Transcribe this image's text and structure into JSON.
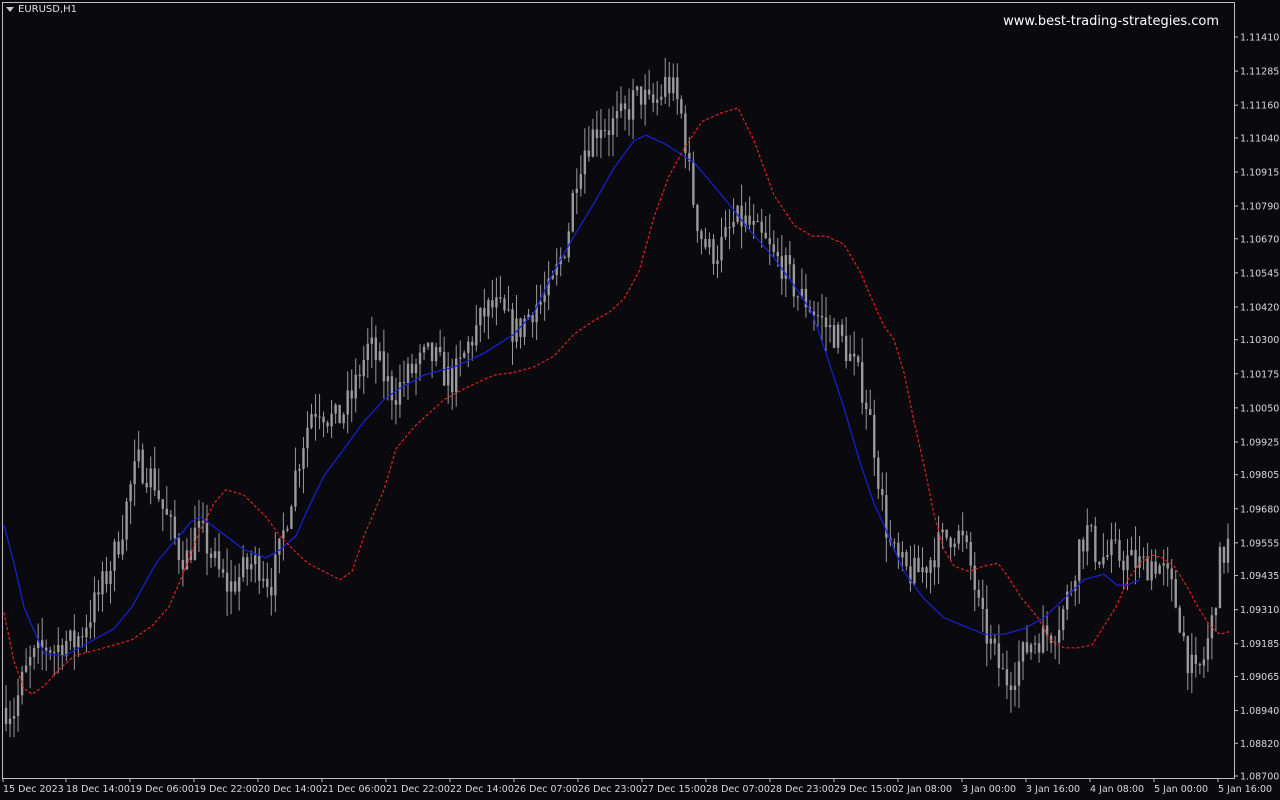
{
  "window": {
    "symbol_title": "EURUSD,H1",
    "watermark": "www.best-trading-strategies.com"
  },
  "colors": {
    "background": "#0a0a0e",
    "frame": "#bfbfbf",
    "candle": "#9a9a9a",
    "slow_ma": "#1a20d8",
    "fast_ma": "#e02020",
    "axis_text": "#d8d8d8"
  },
  "chart_data": {
    "type": "candlestick",
    "symbol": "EURUSD",
    "timeframe": "H1",
    "ylim": [
      1.087,
      1.115
    ],
    "y_ticks": [
      "1.11410",
      "1.11285",
      "1.11160",
      "1.11040",
      "1.10915",
      "1.10790",
      "1.10670",
      "1.10545",
      "1.10420",
      "1.10300",
      "1.10175",
      "1.10050",
      "1.09925",
      "1.09805",
      "1.09680",
      "1.09555",
      "1.09435",
      "1.09310",
      "1.09185",
      "1.09065",
      "1.08940",
      "1.08820",
      "1.08700"
    ],
    "x_ticks": [
      "15 Dec 2023",
      "18 Dec 14:00",
      "19 Dec 06:00",
      "19 Dec 22:00",
      "20 Dec 14:00",
      "21 Dec 06:00",
      "21 Dec 22:00",
      "22 Dec 14:00",
      "26 Dec 07:00",
      "26 Dec 23:00",
      "27 Dec 15:00",
      "28 Dec 07:00",
      "28 Dec 23:00",
      "29 Dec 15:00",
      "2 Jan 08:00",
      "3 Jan 00:00",
      "3 Jan 16:00",
      "4 Jan 08:00",
      "5 Jan 00:00",
      "5 Jan 16:00"
    ],
    "grid": false,
    "bar_count": 305,
    "close_path": [
      [
        0,
        1.0895
      ],
      [
        6,
        1.0894
      ],
      [
        12,
        1.0905
      ],
      [
        18,
        1.0912
      ],
      [
        24,
        1.0915
      ],
      [
        30,
        1.0918
      ],
      [
        36,
        1.0916
      ],
      [
        42,
        1.092
      ],
      [
        48,
        1.0918
      ],
      [
        54,
        1.0922
      ],
      [
        60,
        1.0928
      ],
      [
        66,
        1.0935
      ],
      [
        72,
        1.0942
      ],
      [
        78,
        1.095
      ],
      [
        84,
        1.096
      ],
      [
        90,
        1.0975
      ],
      [
        96,
        1.0985
      ],
      [
        102,
        1.0982
      ],
      [
        108,
        1.0978
      ],
      [
        114,
        1.0968
      ],
      [
        120,
        1.096
      ],
      [
        126,
        1.0952
      ],
      [
        132,
        1.095
      ],
      [
        138,
        1.096
      ],
      [
        144,
        1.0957
      ],
      [
        150,
        1.095
      ],
      [
        156,
        1.0943
      ],
      [
        162,
        1.0939
      ],
      [
        168,
        1.0942
      ],
      [
        174,
        1.0946
      ],
      [
        180,
        1.0948
      ],
      [
        186,
        1.0947
      ],
      [
        192,
        1.094
      ],
      [
        198,
        1.095
      ],
      [
        204,
        1.0965
      ],
      [
        210,
        1.098
      ],
      [
        216,
        1.0993
      ],
      [
        222,
        1.1004
      ],
      [
        228,
        1.1006
      ],
      [
        234,
        1.1002
      ],
      [
        240,
        1.1
      ],
      [
        246,
        1.1004
      ],
      [
        252,
        1.101
      ],
      [
        258,
        1.102
      ],
      [
        264,
        1.1028
      ],
      [
        270,
        1.1022
      ],
      [
        276,
        1.1015
      ],
      [
        282,
        1.101
      ],
      [
        288,
        1.1014
      ],
      [
        294,
        1.1018
      ],
      [
        300,
        1.1021
      ],
      [
        306,
        1.1024
      ],
      [
        312,
        1.1023
      ],
      [
        318,
        1.1018
      ],
      [
        324,
        1.1015
      ],
      [
        330,
        1.102
      ],
      [
        336,
        1.1028
      ],
      [
        342,
        1.1034
      ],
      [
        348,
        1.104
      ],
      [
        354,
        1.1042
      ],
      [
        360,
        1.104
      ],
      [
        366,
        1.1035
      ],
      [
        372,
        1.1033
      ],
      [
        378,
        1.1038
      ],
      [
        384,
        1.1043
      ],
      [
        390,
        1.1044
      ],
      [
        396,
        1.1048
      ],
      [
        402,
        1.1058
      ],
      [
        408,
        1.1068
      ],
      [
        414,
        1.109
      ],
      [
        420,
        1.11
      ],
      [
        426,
        1.1105
      ],
      [
        432,
        1.111
      ],
      [
        438,
        1.1108
      ],
      [
        444,
        1.111
      ],
      [
        450,
        1.1112
      ],
      [
        456,
        1.1118
      ],
      [
        462,
        1.112
      ],
      [
        468,
        1.1115
      ],
      [
        474,
        1.1118
      ],
      [
        480,
        1.1125
      ],
      [
        486,
        1.112
      ],
      [
        492,
        1.111
      ],
      [
        498,
        1.1085
      ],
      [
        504,
        1.107
      ],
      [
        510,
        1.1063
      ],
      [
        516,
        1.1062
      ],
      [
        522,
        1.1066
      ],
      [
        528,
        1.1072
      ],
      [
        534,
        1.1074
      ],
      [
        540,
        1.1072
      ],
      [
        546,
        1.1068
      ],
      [
        552,
        1.1065
      ],
      [
        558,
        1.106
      ],
      [
        564,
        1.1058
      ],
      [
        570,
        1.1052
      ],
      [
        576,
        1.1046
      ],
      [
        582,
        1.1044
      ],
      [
        588,
        1.104
      ],
      [
        594,
        1.1036
      ],
      [
        600,
        1.1033
      ],
      [
        606,
        1.1031
      ],
      [
        612,
        1.1025
      ],
      [
        618,
        1.1018
      ],
      [
        624,
        1.101
      ],
      [
        630,
        1.0995
      ],
      [
        636,
        1.0972
      ],
      [
        642,
        1.0955
      ],
      [
        648,
        1.0948
      ],
      [
        654,
        1.0945
      ],
      [
        660,
        1.0944
      ],
      [
        666,
        1.0946
      ],
      [
        672,
        1.095
      ],
      [
        678,
        1.0955
      ],
      [
        684,
        1.0958
      ],
      [
        690,
        1.096
      ],
      [
        696,
        1.0955
      ],
      [
        702,
        1.0945
      ],
      [
        708,
        1.0928
      ],
      [
        714,
        1.092
      ],
      [
        720,
        1.0912
      ],
      [
        726,
        1.0905
      ],
      [
        732,
        1.0908
      ],
      [
        738,
        1.0913
      ],
      [
        744,
        1.0919
      ],
      [
        750,
        1.0921
      ],
      [
        756,
        1.0922
      ],
      [
        762,
        1.0924
      ],
      [
        768,
        1.093
      ],
      [
        774,
        1.094
      ],
      [
        780,
        1.0955
      ],
      [
        786,
        1.096
      ],
      [
        792,
        1.0952
      ],
      [
        798,
        1.095
      ],
      [
        804,
        1.0952
      ],
      [
        810,
        1.095
      ],
      [
        816,
        1.0949
      ],
      [
        822,
        1.0948
      ],
      [
        828,
        1.0947
      ],
      [
        834,
        1.0949
      ],
      [
        840,
        1.0946
      ],
      [
        846,
        1.094
      ],
      [
        852,
        1.093
      ],
      [
        858,
        1.0915
      ],
      [
        864,
        1.0905
      ],
      [
        870,
        1.0912
      ],
      [
        876,
        1.0925
      ],
      [
        882,
        1.0948
      ],
      [
        888,
        1.0955
      ]
    ],
    "series": [
      {
        "name": "",
        "color": "#1a20d8",
        "style": "solid",
        "points": [
          [
            0,
            1.0962
          ],
          [
            10,
            1.0948
          ],
          [
            20,
            1.0932
          ],
          [
            28,
            1.0925
          ],
          [
            40,
            1.0915
          ],
          [
            60,
            1.0914
          ],
          [
            80,
            1.0918
          ],
          [
            110,
            1.0924
          ],
          [
            128,
            1.0932
          ],
          [
            140,
            1.094
          ],
          [
            152,
            1.0948
          ],
          [
            170,
            1.0956
          ],
          [
            180,
            1.096
          ],
          [
            186,
            1.0963
          ],
          [
            196,
            1.0965
          ],
          [
            204,
            1.0963
          ],
          [
            222,
            1.0958
          ],
          [
            240,
            1.0953
          ],
          [
            262,
            1.095
          ],
          [
            276,
            1.0953
          ],
          [
            292,
            1.0958
          ],
          [
            304,
            1.0968
          ],
          [
            320,
            1.098
          ],
          [
            340,
            1.099
          ],
          [
            360,
            1.1
          ],
          [
            380,
            1.1008
          ],
          [
            395,
            1.1012
          ],
          [
            420,
            1.1017
          ],
          [
            450,
            1.102
          ],
          [
            480,
            1.1025
          ],
          [
            510,
            1.1032
          ],
          [
            530,
            1.104
          ],
          [
            550,
            1.1055
          ],
          [
            570,
            1.1068
          ],
          [
            590,
            1.108
          ],
          [
            610,
            1.1093
          ],
          [
            630,
            1.1103
          ],
          [
            642,
            1.1105
          ],
          [
            660,
            1.1102
          ],
          [
            690,
            1.1095
          ],
          [
            720,
            1.1082
          ],
          [
            746,
            1.107
          ],
          [
            770,
            1.106
          ],
          [
            790,
            1.105
          ],
          [
            808,
            1.104
          ],
          [
            822,
            1.1025
          ],
          [
            840,
            1.1005
          ],
          [
            856,
            1.0985
          ],
          [
            870,
            1.097
          ],
          [
            880,
            1.0962
          ],
          [
            888,
            1.0955
          ],
          [
            900,
            1.0945
          ],
          [
            920,
            1.0935
          ],
          [
            940,
            1.0928
          ],
          [
            960,
            1.0925
          ],
          [
            980,
            1.0922
          ],
          [
            1000,
            1.0922
          ],
          [
            1020,
            1.0924
          ],
          [
            1040,
            1.0928
          ],
          [
            1060,
            1.0935
          ],
          [
            1080,
            1.0942
          ],
          [
            1100,
            1.0944
          ],
          [
            1113,
            1.094
          ],
          [
            1123,
            1.094
          ],
          [
            1136,
            1.0942
          ]
        ]
      },
      {
        "name": "",
        "color": "#e02020",
        "style": "dashed",
        "points": [
          [
            0,
            1.093
          ],
          [
            10,
            1.0912
          ],
          [
            20,
            1.0902
          ],
          [
            28,
            1.09
          ],
          [
            40,
            1.0903
          ],
          [
            55,
            1.0909
          ],
          [
            70,
            1.0914
          ],
          [
            90,
            1.0916
          ],
          [
            110,
            1.0918
          ],
          [
            128,
            1.092
          ],
          [
            148,
            1.0925
          ],
          [
            165,
            1.0932
          ],
          [
            180,
            1.0945
          ],
          [
            196,
            1.096
          ],
          [
            210,
            1.097
          ],
          [
            222,
            1.0975
          ],
          [
            240,
            1.0973
          ],
          [
            262,
            1.0965
          ],
          [
            276,
            1.0958
          ],
          [
            292,
            1.0952
          ],
          [
            304,
            1.0948
          ],
          [
            320,
            1.0945
          ],
          [
            336,
            1.0942
          ],
          [
            348,
            1.0945
          ],
          [
            360,
            1.0958
          ],
          [
            380,
            1.0975
          ],
          [
            392,
            1.099
          ],
          [
            410,
            1.0998
          ],
          [
            425,
            1.1003
          ],
          [
            440,
            1.1008
          ],
          [
            460,
            1.1012
          ],
          [
            490,
            1.1017
          ],
          [
            510,
            1.1018
          ],
          [
            530,
            1.102
          ],
          [
            550,
            1.1024
          ],
          [
            570,
            1.1032
          ],
          [
            590,
            1.1037
          ],
          [
            605,
            1.104
          ],
          [
            620,
            1.1045
          ],
          [
            635,
            1.1055
          ],
          [
            650,
            1.1075
          ],
          [
            665,
            1.109
          ],
          [
            680,
            1.11
          ],
          [
            698,
            1.111
          ],
          [
            716,
            1.1113
          ],
          [
            734,
            1.1115
          ],
          [
            750,
            1.1103
          ],
          [
            770,
            1.1083
          ],
          [
            790,
            1.1072
          ],
          [
            808,
            1.1068
          ],
          [
            822,
            1.1068
          ],
          [
            840,
            1.1065
          ],
          [
            856,
            1.1055
          ],
          [
            870,
            1.1043
          ],
          [
            880,
            1.1035
          ],
          [
            890,
            1.103
          ],
          [
            900,
            1.1018
          ],
          [
            910,
            1.1
          ],
          [
            920,
            1.0984
          ],
          [
            930,
            1.0966
          ],
          [
            940,
            1.0953
          ],
          [
            950,
            1.0947
          ],
          [
            965,
            1.0945
          ],
          [
            980,
            1.0947
          ],
          [
            994,
            1.0948
          ],
          [
            1004,
            1.0943
          ],
          [
            1018,
            1.0935
          ],
          [
            1034,
            1.0928
          ],
          [
            1046,
            1.092
          ],
          [
            1060,
            1.0917
          ],
          [
            1074,
            1.0917
          ],
          [
            1088,
            1.0918
          ],
          [
            1100,
            1.0925
          ],
          [
            1112,
            1.0932
          ],
          [
            1124,
            1.0942
          ],
          [
            1136,
            1.0948
          ],
          [
            1148,
            1.0951
          ],
          [
            1158,
            1.095
          ],
          [
            1170,
            1.0947
          ],
          [
            1182,
            1.094
          ],
          [
            1194,
            1.0932
          ],
          [
            1206,
            1.0925
          ],
          [
            1216,
            1.0922
          ],
          [
            1226,
            1.0923
          ]
        ]
      }
    ]
  }
}
